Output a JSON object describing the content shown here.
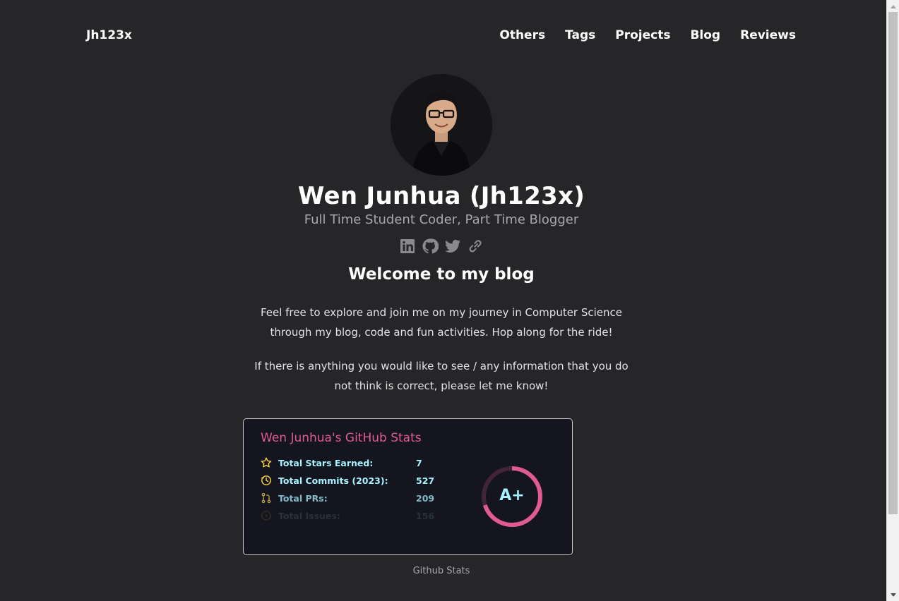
{
  "header": {
    "site_title": "Jh123x",
    "nav": [
      "Others",
      "Tags",
      "Projects",
      "Blog",
      "Reviews"
    ]
  },
  "profile": {
    "name": "Wen Junhua (Jh123x)",
    "subtitle": "Full Time Student Coder, Part Time Blogger",
    "socials": [
      "linkedin-icon",
      "github-icon",
      "twitter-icon",
      "link-icon"
    ]
  },
  "content": {
    "welcome": "Welcome to my blog",
    "para1": "Feel free to explore and join me on my journey in Computer Science through my blog, code and fun activities. Hop along for the ride!",
    "para2": "If there is anything you would like to see / any information that you do not think is correct, please let me know!"
  },
  "stats": {
    "title": "Wen Junhua's GitHub Stats",
    "rows": [
      {
        "label": "Total Stars Earned:",
        "value": "7",
        "icon": "star-icon"
      },
      {
        "label": "Total Commits (2023):",
        "value": "527",
        "icon": "clock-icon"
      },
      {
        "label": "Total PRs:",
        "value": "209",
        "icon": "pull-request-icon"
      },
      {
        "label": "Total Issues:",
        "value": "156",
        "icon": "issue-icon"
      }
    ],
    "rank": "A+",
    "rank_progress": 0.7,
    "caption": "Github Stats",
    "colors": {
      "title": "#e05a93",
      "text": "#a6f2ff",
      "icon": "#f8d847",
      "ring": "#e05a93"
    }
  }
}
